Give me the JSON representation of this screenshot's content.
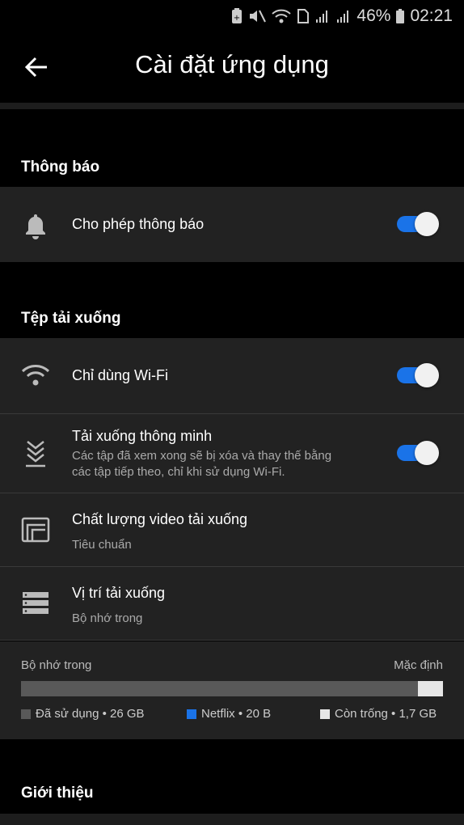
{
  "status_bar": {
    "battery": "46%",
    "time": "02:21"
  },
  "header": {
    "title": "Cài đặt ứng dụng"
  },
  "sections": {
    "notifications": {
      "title": "Thông báo",
      "allow": {
        "label": "Cho phép thông báo",
        "enabled": true
      }
    },
    "downloads": {
      "title": "Tệp tải xuống",
      "wifi_only": {
        "label": "Chỉ dùng Wi-Fi",
        "enabled": true
      },
      "smart_downloads": {
        "label": "Tải xuống thông minh",
        "description_line1": "Các tập đã xem xong sẽ bị xóa và thay thế bằng",
        "description_line2": "các tập tiếp theo, chỉ khi sử dụng Wi-Fi.",
        "enabled": true
      },
      "video_quality": {
        "label": "Chất lượng video tải xuống",
        "value": "Tiêu chuẩn"
      },
      "location": {
        "label": "Vị trí tải xuống",
        "value": "Bộ nhớ trong"
      }
    },
    "storage": {
      "name": "Bộ nhớ trong",
      "default_label": "Mặc định",
      "used_fraction": 0.94,
      "legend": [
        {
          "label": "Đã sử dụng • 26 GB",
          "color": "#595959"
        },
        {
          "label": "Netflix • 20 B",
          "color": "#1a73e8"
        },
        {
          "label": "Còn trống • 1,7 GB",
          "color": "#e6e6e6"
        }
      ]
    },
    "about": {
      "title": "Giới thiệu"
    }
  },
  "colors": {
    "accent": "#1a73e8",
    "background": "#000000",
    "row": "#222222"
  }
}
